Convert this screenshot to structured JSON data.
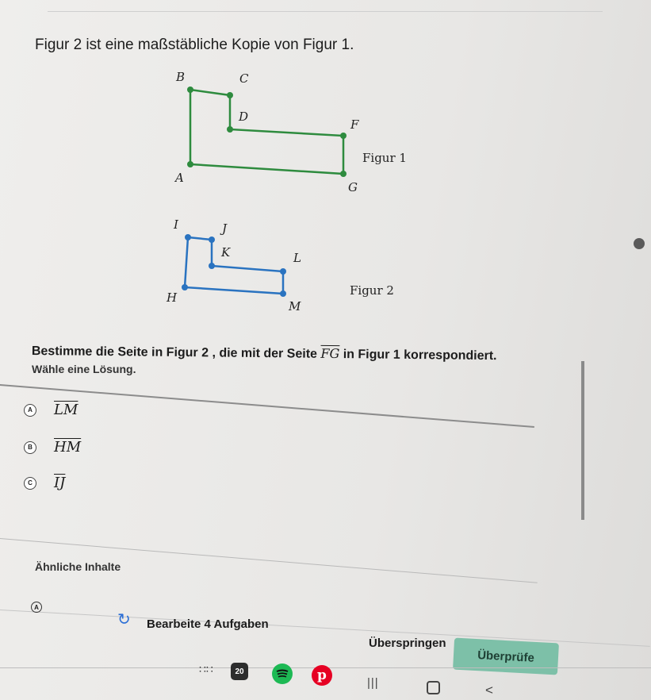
{
  "intro": "Figur 2 ist eine maßstäbliche Kopie von Figur 1.",
  "figur1": {
    "label": "Figur 1",
    "vertices": {
      "A": "A",
      "B": "B",
      "C": "C",
      "D": "D",
      "F": "F",
      "G": "G"
    },
    "color": "#2e8b3e"
  },
  "figur2": {
    "label": "Figur 2",
    "vertices": {
      "H": "H",
      "I": "I",
      "J": "J",
      "K": "K",
      "L": "L",
      "M": "M"
    },
    "color": "#2a73c0"
  },
  "question": {
    "before": "Bestimme die Seite in Figur 2 , die mit der Seite ",
    "segment": "FG",
    "after": " in Figur 1 korrespondiert."
  },
  "prompt": "Wähle eine Lösung.",
  "options": [
    {
      "letter": "A",
      "label": "LM"
    },
    {
      "letter": "B",
      "label": "HM"
    },
    {
      "letter": "C",
      "label": "IJ"
    }
  ],
  "similar": "Ähnliche Inhalte",
  "footer": {
    "accessibility_letter": "A",
    "work_tasks": "Bearbeite 4 Aufgaben",
    "skip": "Überspringen",
    "check": "Überprüfe"
  },
  "taskbar": {
    "calendar_day": "20",
    "pinterest_letter": "p",
    "recents_glyph": "|||",
    "back_glyph": "<"
  },
  "colors": {
    "accent": "#7dc0a8",
    "refresh": "#2c6fd6"
  }
}
